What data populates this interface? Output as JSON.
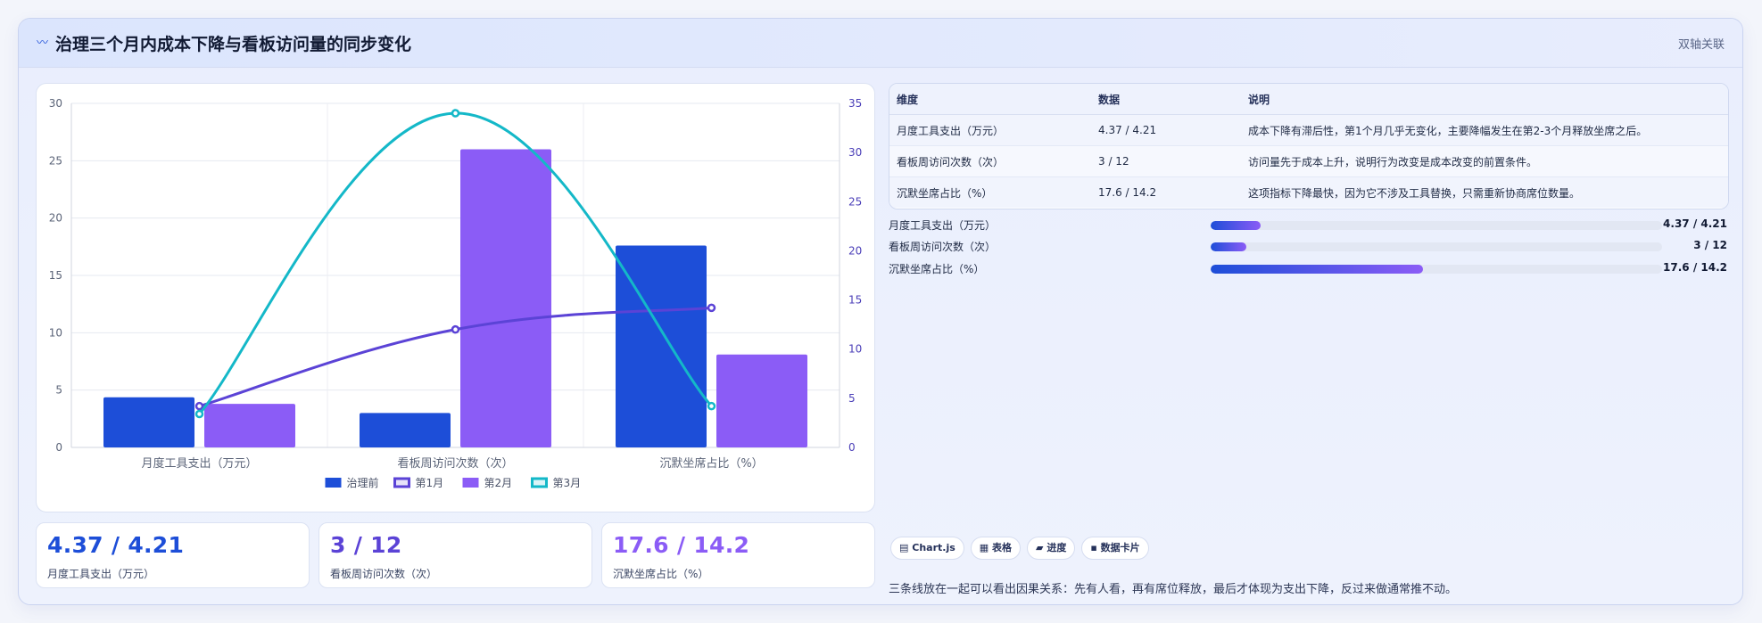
{
  "header": {
    "icon": "trend-icon",
    "icon_glyph": "〰",
    "title": "治理三个月内成本下降与看板访问量的同步变化",
    "tag": "双轴关联"
  },
  "chart_data": {
    "type": "bar",
    "categories": [
      "月度工具支出（万元）",
      "看板周访问次数（次）",
      "沉默坐席占比（%）"
    ],
    "series": [
      {
        "name": "治理前",
        "kind": "bar",
        "axis": "left",
        "color": "#1d4ed8",
        "values": [
          4.37,
          3,
          17.6
        ]
      },
      {
        "name": "第1月",
        "kind": "line",
        "axis": "right",
        "color": "#5b43d6",
        "values": [
          4.2,
          12,
          14.2
        ]
      },
      {
        "name": "第2月",
        "kind": "bar",
        "axis": "left",
        "color": "#8b5cf6",
        "values": [
          3.8,
          26,
          8.1
        ]
      },
      {
        "name": "第3月",
        "kind": "line",
        "axis": "right",
        "color": "#14b8c8",
        "values": [
          3.4,
          34,
          4.2
        ]
      }
    ],
    "y_left": {
      "min": 0,
      "max": 30,
      "ticks": [
        0,
        5,
        10,
        15,
        20,
        25,
        30
      ]
    },
    "y_right": {
      "min": 0,
      "max": 35,
      "ticks": [
        0,
        5,
        10,
        15,
        20,
        25,
        30,
        35
      ]
    },
    "grid": true,
    "legend_position": "bottom"
  },
  "kpis": [
    {
      "value": "4.37 / 4.21",
      "label": "月度工具支出（万元）",
      "color": "#1d4ed8"
    },
    {
      "value": "3 / 12",
      "label": "看板周访问次数（次）",
      "color": "#5b43d6"
    },
    {
      "value": "17.6 / 14.2",
      "label": "沉默坐席占比（%）",
      "color": "#8b5cf6"
    }
  ],
  "table": {
    "headers": [
      "维度",
      "数据",
      "说明"
    ],
    "rows": [
      {
        "dim": "月度工具支出（万元）",
        "data": "4.37 / 4.21",
        "note": "成本下降有滞后性，第1个月几乎无变化，主要降幅发生在第2-3个月释放坐席之后。"
      },
      {
        "dim": "看板周访问次数（次）",
        "data": "3 / 12",
        "note": "访问量先于成本上升，说明行为改变是成本改变的前置条件。"
      },
      {
        "dim": "沉默坐席占比（%）",
        "data": "17.6 / 14.2",
        "note": "这项指标下降最快，因为它不涉及工具替换，只需重新协商席位数量。"
      }
    ]
  },
  "progress": [
    {
      "label": "月度工具支出（万元）",
      "value": "4.37 / 4.21",
      "fraction": 0.11
    },
    {
      "label": "看板周访问次数（次）",
      "value": "3 / 12",
      "fraction": 0.08
    },
    {
      "label": "沉默坐席占比（%）",
      "value": "17.6 / 14.2",
      "fraction": 0.47
    }
  ],
  "chips": [
    {
      "icon": "chart-icon",
      "glyph": "▤",
      "label": "Chart.js"
    },
    {
      "icon": "table-icon",
      "glyph": "▦",
      "label": "表格"
    },
    {
      "icon": "progress-icon",
      "glyph": "▰",
      "label": "进度"
    },
    {
      "icon": "card-icon",
      "glyph": "▪",
      "label": "数据卡片"
    }
  ],
  "footnote": "三条线放在一起可以看出因果关系：先有人看，再有席位释放，最后才体现为支出下降，反过来做通常推不动。"
}
